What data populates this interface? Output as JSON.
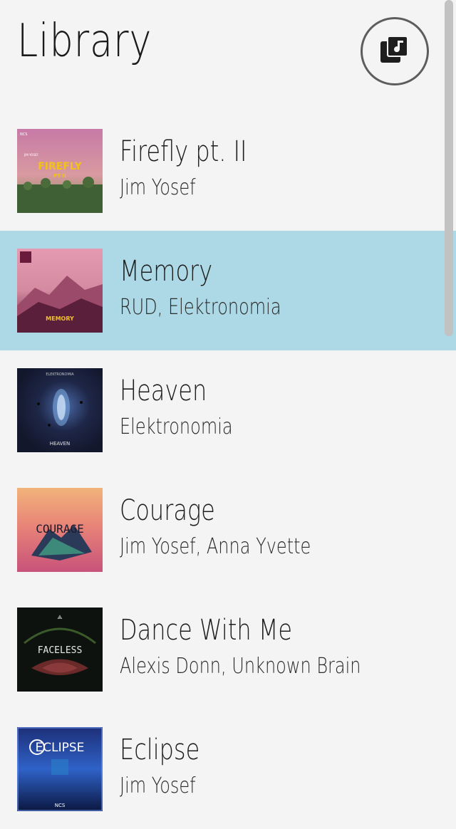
{
  "header": {
    "title": "Library",
    "playlist_icon": "music-library-icon"
  },
  "songs": [
    {
      "title": "Firefly pt. II",
      "artist": "Jim Yosef",
      "art_text": "FIREFLY",
      "art_subtext": "PT II",
      "art_top_left": "NCS",
      "art_top": "JIM YOSEF"
    },
    {
      "title": "Memory",
      "artist": "RUD, Elektronomia",
      "art_text": "MEMORY"
    },
    {
      "title": "Heaven",
      "artist": "Elektronomia",
      "art_text": "HEAVEN",
      "art_top": "ELEKTRONOMIA"
    },
    {
      "title": "Courage",
      "artist": "Jim Yosef, Anna Yvette",
      "art_text": "COURAGE"
    },
    {
      "title": "Dance With Me",
      "artist": "Alexis Donn, Unknown Brain",
      "art_text": "FACELESS"
    },
    {
      "title": "Eclipse",
      "artist": "Jim Yosef",
      "art_text": "ECLIPSE",
      "art_subtext": "NCS"
    }
  ],
  "selected_index": 1,
  "colors": {
    "background": "#f4f4f4",
    "selected_row": "#add8e6",
    "text": "#1e1e1e",
    "icon_ring": "#5d5d5d"
  }
}
